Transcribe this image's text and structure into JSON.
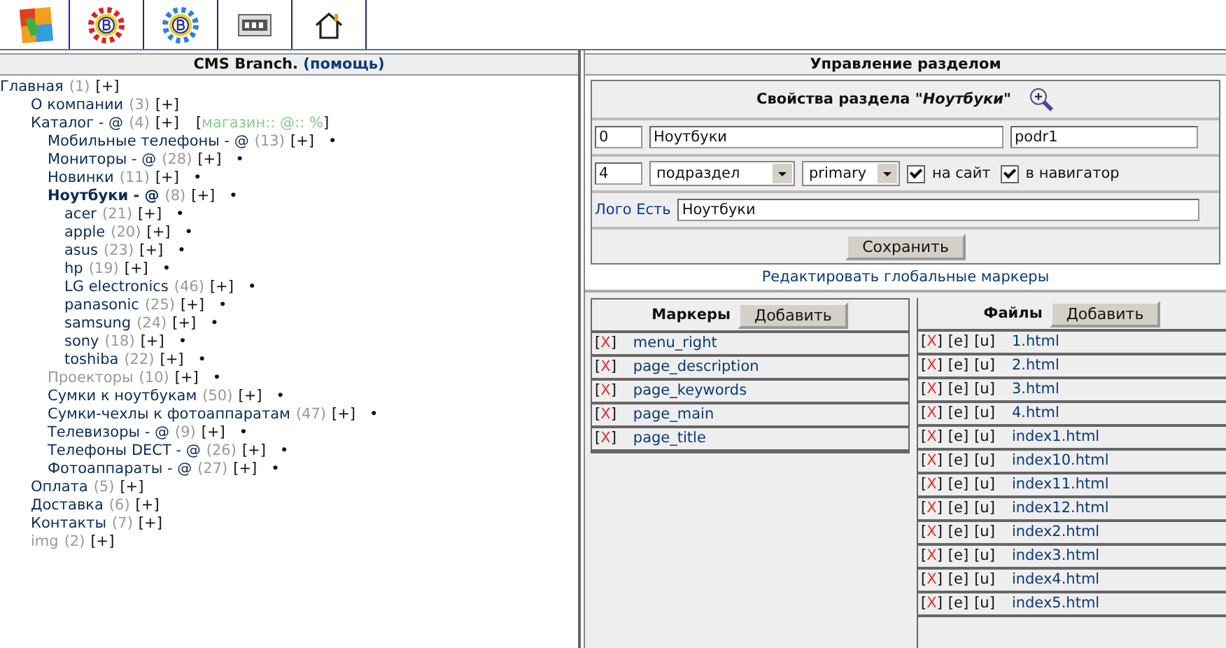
{
  "tree_panel": {
    "title": "CMS Branch.",
    "help": "(помощь)",
    "tree": [
      {
        "label": "Главная",
        "count": "(1)",
        "add": "[+]",
        "selected": false,
        "hidden": false,
        "children": [
          {
            "label": "О компании",
            "count": "(3)",
            "add": "[+]",
            "selected": false,
            "hidden": false
          },
          {
            "label": "Каталог - @",
            "count": "(4)",
            "add": "[+]",
            "tag": "[магазин:: @:: %]",
            "selected": false,
            "hidden": false,
            "children": [
              {
                "label": "Мобильные телефоны - @",
                "count": "(13)",
                "add": "[+]",
                "marker": "•",
                "selected": false,
                "hidden": false
              },
              {
                "label": "Мониторы - @",
                "count": "(28)",
                "add": "[+]",
                "marker": "•",
                "selected": false,
                "hidden": false
              },
              {
                "label": "Новинки",
                "count": "(11)",
                "add": "[+]",
                "marker": "•",
                "selected": false,
                "hidden": false
              },
              {
                "label": "Ноутбуки - @",
                "count": "(8)",
                "add": "[+]",
                "marker": "•",
                "selected": true,
                "hidden": false,
                "children": [
                  {
                    "label": "acer",
                    "count": "(21)",
                    "add": "[+]",
                    "marker": "•",
                    "selected": false,
                    "hidden": false
                  },
                  {
                    "label": "apple",
                    "count": "(20)",
                    "add": "[+]",
                    "marker": "•",
                    "selected": false,
                    "hidden": false
                  },
                  {
                    "label": "asus",
                    "count": "(23)",
                    "add": "[+]",
                    "marker": "•",
                    "selected": false,
                    "hidden": false
                  },
                  {
                    "label": "hp",
                    "count": "(19)",
                    "add": "[+]",
                    "marker": "•",
                    "selected": false,
                    "hidden": false
                  },
                  {
                    "label": "LG electronics",
                    "count": "(46)",
                    "add": "[+]",
                    "marker": "•",
                    "selected": false,
                    "hidden": false
                  },
                  {
                    "label": "panasonic",
                    "count": "(25)",
                    "add": "[+]",
                    "marker": "•",
                    "selected": false,
                    "hidden": false
                  },
                  {
                    "label": "samsung",
                    "count": "(24)",
                    "add": "[+]",
                    "marker": "•",
                    "selected": false,
                    "hidden": false
                  },
                  {
                    "label": "sony",
                    "count": "(18)",
                    "add": "[+]",
                    "marker": "•",
                    "selected": false,
                    "hidden": false
                  },
                  {
                    "label": "toshiba",
                    "count": "(22)",
                    "add": "[+]",
                    "marker": "•",
                    "selected": false,
                    "hidden": false
                  }
                ]
              },
              {
                "label": "Проекторы",
                "count": "(10)",
                "add": "[+]",
                "marker": "•",
                "selected": false,
                "hidden": true
              },
              {
                "label": "Сумки к ноутбукам",
                "count": "(50)",
                "add": "[+]",
                "marker": "•",
                "selected": false,
                "hidden": false
              },
              {
                "label": "Сумки-чехлы к фотоаппаратам",
                "count": "(47)",
                "add": "[+]",
                "marker": "•",
                "selected": false,
                "hidden": false
              },
              {
                "label": "Телевизоры - @",
                "count": "(9)",
                "add": "[+]",
                "marker": "•",
                "selected": false,
                "hidden": false
              },
              {
                "label": "Телефоны DECT - @",
                "count": "(26)",
                "add": "[+]",
                "marker": "•",
                "selected": false,
                "hidden": false
              },
              {
                "label": "Фотоаппараты - @",
                "count": "(27)",
                "add": "[+]",
                "marker": "•",
                "selected": false,
                "hidden": false
              }
            ]
          },
          {
            "label": "Оплата",
            "count": "(5)",
            "add": "[+]",
            "selected": false,
            "hidden": false
          },
          {
            "label": "Доставка",
            "count": "(6)",
            "add": "[+]",
            "selected": false,
            "hidden": false
          },
          {
            "label": "Контакты",
            "count": "(7)",
            "add": "[+]",
            "selected": false,
            "hidden": false
          },
          {
            "label": "img",
            "count": "(2)",
            "add": "[+]",
            "selected": false,
            "hidden": true
          }
        ]
      }
    ]
  },
  "section_panel": {
    "title": "Управление разделом",
    "properties": {
      "title": "Свойства раздела \"*Ноутбуки*\"",
      "order": "0",
      "name": "Ноутбуки",
      "alias": "podr1",
      "level": "4",
      "type": "подраздел",
      "template": "primary",
      "on_site": {
        "label": "на сайт",
        "checked": true
      },
      "in_navigator": {
        "label": "в навигатор",
        "checked": true
      },
      "logo_label": "Лого Есть",
      "logo_value": "Ноутбуки",
      "save": "Сохранить"
    },
    "global_markers_link": "Редактировать глобальные маркеры",
    "markers": {
      "title": "Маркеры",
      "add": "Добавить",
      "items": [
        {
          "delete": "[X]",
          "name": "menu_right"
        },
        {
          "delete": "[X]",
          "name": "page_description"
        },
        {
          "delete": "[X]",
          "name": "page_keywords"
        },
        {
          "delete": "[X]",
          "name": "page_main"
        },
        {
          "delete": "[X]",
          "name": "page_title"
        }
      ]
    },
    "files": {
      "title": "Файлы",
      "add": "Добавить",
      "items": [
        {
          "delete": "[X]",
          "edit": "[e]",
          "upload": "[u]",
          "name": "1.html"
        },
        {
          "delete": "[X]",
          "edit": "[e]",
          "upload": "[u]",
          "name": "2.html"
        },
        {
          "delete": "[X]",
          "edit": "[e]",
          "upload": "[u]",
          "name": "3.html"
        },
        {
          "delete": "[X]",
          "edit": "[e]",
          "upload": "[u]",
          "name": "4.html"
        },
        {
          "delete": "[X]",
          "edit": "[e]",
          "upload": "[u]",
          "name": "index1.html"
        },
        {
          "delete": "[X]",
          "edit": "[e]",
          "upload": "[u]",
          "name": "index10.html"
        },
        {
          "delete": "[X]",
          "edit": "[e]",
          "upload": "[u]",
          "name": "index11.html"
        },
        {
          "delete": "[X]",
          "edit": "[e]",
          "upload": "[u]",
          "name": "index12.html"
        },
        {
          "delete": "[X]",
          "edit": "[e]",
          "upload": "[u]",
          "name": "index2.html"
        },
        {
          "delete": "[X]",
          "edit": "[e]",
          "upload": "[u]",
          "name": "index3.html"
        },
        {
          "delete": "[X]",
          "edit": "[e]",
          "upload": "[u]",
          "name": "index4.html"
        },
        {
          "delete": "[X]",
          "edit": "[e]",
          "upload": "[u]",
          "name": "index5.html"
        }
      ]
    }
  }
}
